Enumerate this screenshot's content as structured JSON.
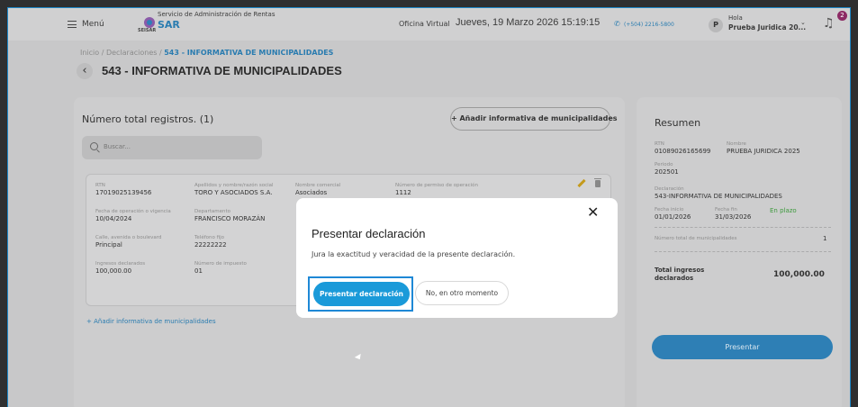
{
  "header": {
    "menu_label": "Menú",
    "org_name": "Servicio de Administración de Rentas",
    "logo_caption": "SEISAR",
    "brand": "SAR",
    "office_label": "Oficina Virtual",
    "datetime": "Jueves, 19 Marzo 2026 15:19:15",
    "phone": "(+504) 2216-5800",
    "avatar_initial": "P",
    "greeting": "Hola",
    "user_name": "Prueba Juridica 20...",
    "notification_count": "2"
  },
  "breadcrumb": {
    "root": "Inicio / Declaraciones / ",
    "current": "543 - INFORMATIVA DE MUNICIPALIDADES"
  },
  "page": {
    "title": "543 - INFORMATIVA DE MUNICIPALIDADES"
  },
  "main": {
    "total_label": "Número total registros. (1)",
    "add_button": "+ Añadir informativa de municipalidades",
    "search_placeholder": "Buscar...",
    "record": {
      "rtn_label": "RTN",
      "rtn_value": "17019025139456",
      "name_label": "Apellidos y nombre/razón social",
      "name_value": "TORO Y ASOCIADOS S.A.",
      "commercial_label": "Nombre comercial",
      "commercial_value": "Asociados",
      "permit_label": "Número de permiso de operación",
      "permit_value": "1112",
      "start_label": "Fecha de operación o vigencia",
      "start_value": "10/04/2024",
      "dept_label": "Departamento",
      "dept_value": "FRANCISCO MORAZÁN",
      "street_label": "Calle, avenida o boulevard",
      "street_value": "Principal",
      "phone_label": "Teléfono fijo",
      "phone_value": "22222222",
      "income_label": "Ingresos declarados",
      "income_value": "100,000.00",
      "tax_label": "Número de impuesto",
      "tax_value": "01"
    },
    "add_link": "+ Añadir informativa de municipalidades"
  },
  "summary": {
    "title": "Resumen",
    "rtn_label": "RTN",
    "rtn_value": "01089026165699",
    "name_label": "Nombre",
    "name_value": "PRUEBA JURIDICA 2025",
    "period_label": "Periodo",
    "period_value": "202501",
    "declaration_label": "Declaración",
    "declaration_value": "543-INFORMATIVA DE MUNICIPALIDADES",
    "start_label": "Fecha inicio",
    "start_value": "01/01/2026",
    "end_label": "Fecha fin",
    "end_value": "31/03/2026",
    "status": "En plazo",
    "count_label": "Número total de municipalidades",
    "count_value": "1",
    "total_label_1": "Total ingresos",
    "total_label_2": "declarados",
    "total_value": "100,000.00",
    "present_button": "Presentar"
  },
  "modal": {
    "title": "Presentar declaración",
    "text": "Jura la exactitud y veracidad de la presente declaración.",
    "confirm_button": "Presentar declaración",
    "cancel_button": "No, en otro momento",
    "close_symbol": "✕"
  },
  "colors": {
    "primary": "#1a9ad9",
    "focus": "#1e88d6",
    "link": "#2a7cb0",
    "status_ok": "#3d9a3d",
    "badge": "#8c2a64"
  }
}
